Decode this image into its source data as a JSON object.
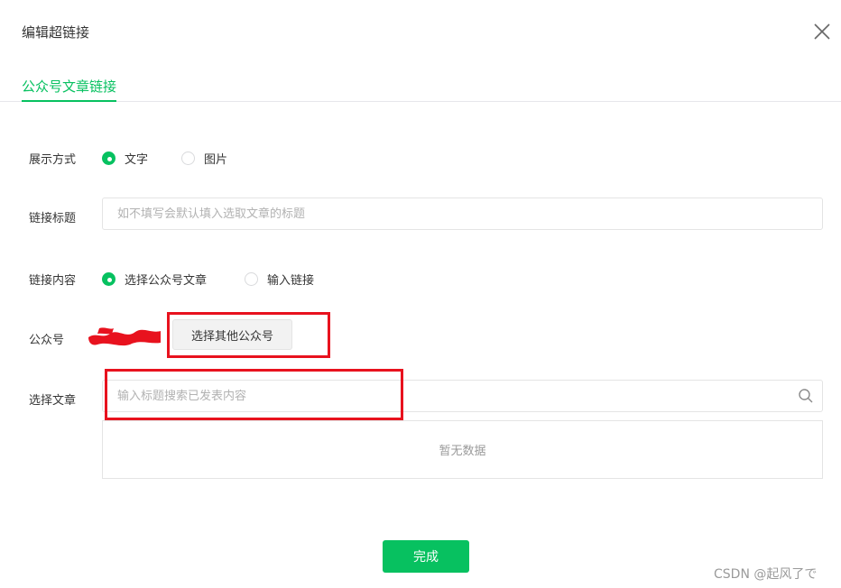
{
  "dialog": {
    "title": "编辑超链接",
    "close_icon": "close-icon"
  },
  "tabs": [
    {
      "label": "公众号文章链接",
      "active": true
    }
  ],
  "form": {
    "display_mode": {
      "label": "展示方式",
      "options": [
        {
          "label": "文字",
          "checked": true
        },
        {
          "label": "图片",
          "checked": false
        }
      ]
    },
    "link_title": {
      "label": "链接标题",
      "value": "",
      "placeholder": "如不填写会默认填入选取文章的标题"
    },
    "link_content": {
      "label": "链接内容",
      "options": [
        {
          "label": "选择公众号文章",
          "checked": true
        },
        {
          "label": "输入链接",
          "checked": false
        }
      ]
    },
    "account": {
      "label": "公众号",
      "select_other_label": "选择其他公众号"
    },
    "select_article": {
      "label": "选择文章",
      "value": "",
      "placeholder": "输入标题搜索已发表内容",
      "search_icon": "search-icon"
    },
    "empty_text": "暂无数据"
  },
  "footer": {
    "done_label": "完成"
  },
  "watermark": "CSDN @起风了で",
  "colors": {
    "accent": "#07c160",
    "highlight": "#e8121e",
    "redaction": "#e8121e"
  }
}
